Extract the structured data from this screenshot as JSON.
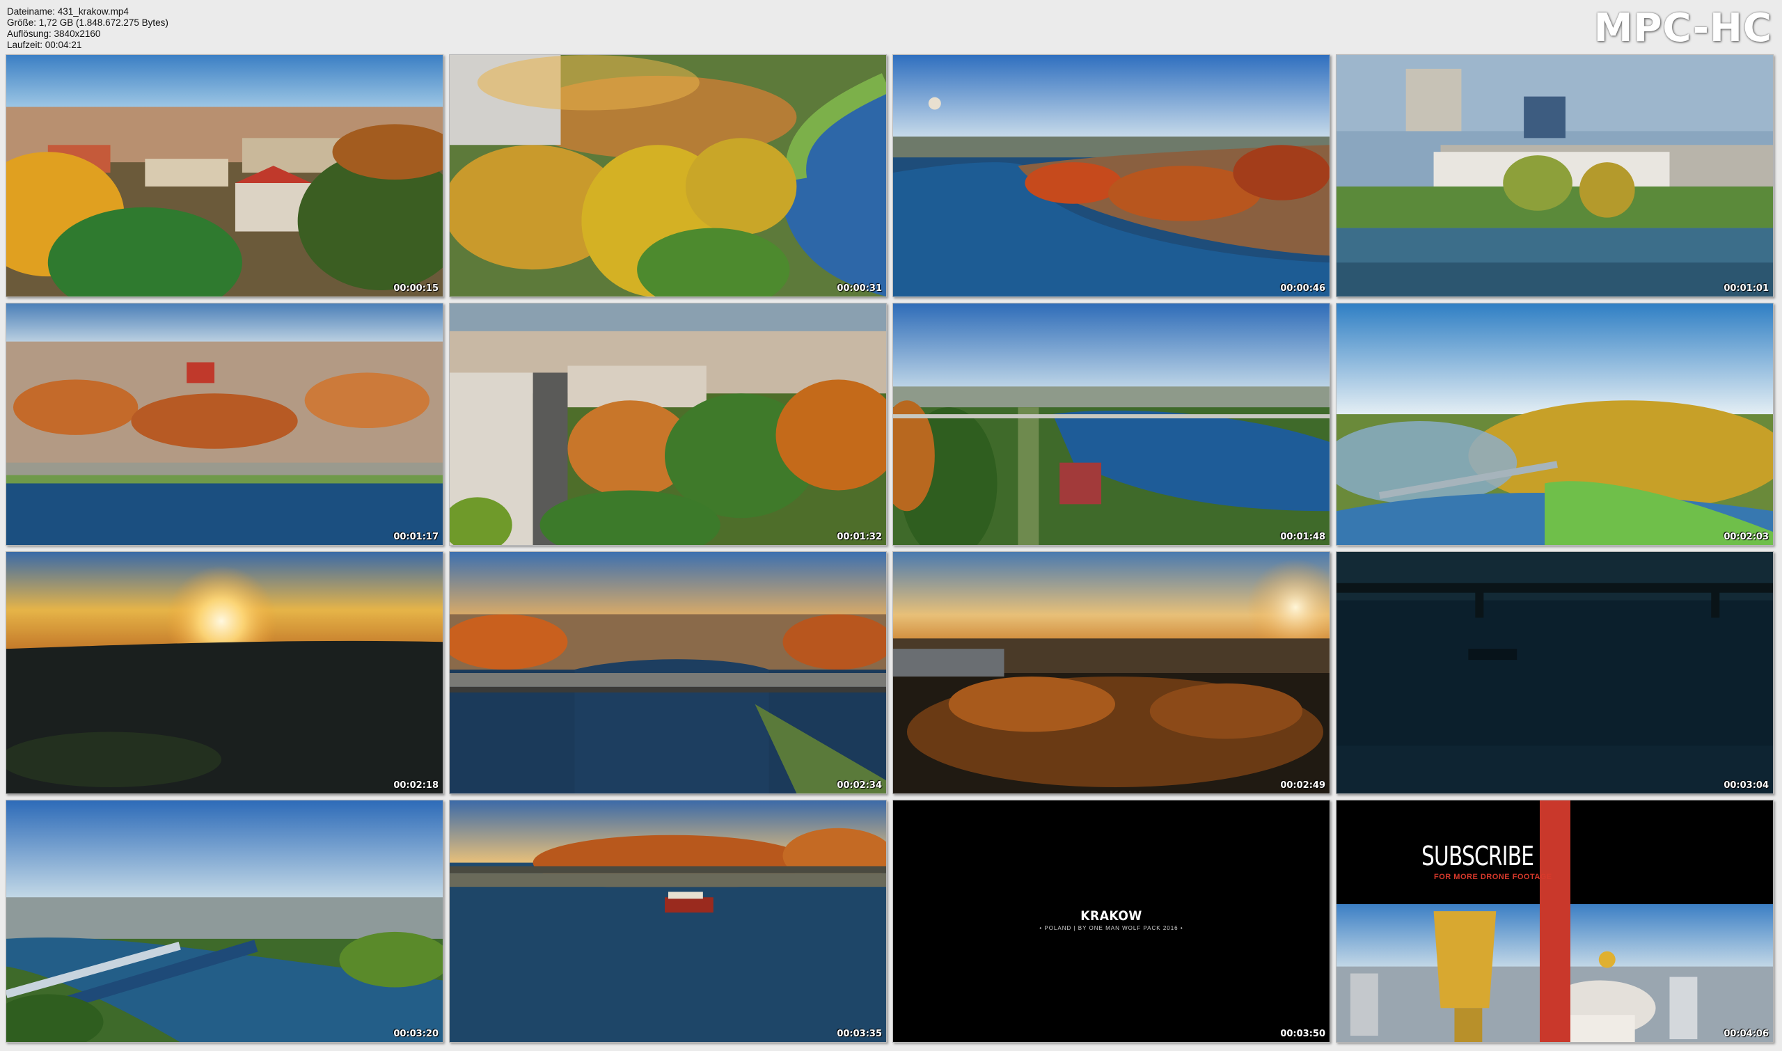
{
  "header": {
    "filename": "Dateiname: 431_krakow.mp4",
    "size": "Größe: 1,72 GB (1.848.672.275 Bytes)",
    "resolution": "Auflösung: 3840x2160",
    "duration": "Laufzeit: 00:04:21"
  },
  "logo": "MPC-HC",
  "thumbnails": [
    {
      "timestamp": "00:00:15",
      "scene": "old-town-autumn"
    },
    {
      "timestamp": "00:00:31",
      "scene": "river-bend-autumn"
    },
    {
      "timestamp": "00:00:46",
      "scene": "river-balloon"
    },
    {
      "timestamp": "00:01:01",
      "scene": "modern-building-river"
    },
    {
      "timestamp": "00:01:17",
      "scene": "city-panorama-river"
    },
    {
      "timestamp": "00:01:32",
      "scene": "street-trees"
    },
    {
      "timestamp": "00:01:48",
      "scene": "river-park"
    },
    {
      "timestamp": "00:02:03",
      "scene": "hazy-bridge-crossfade"
    },
    {
      "timestamp": "00:02:18",
      "scene": "sunset"
    },
    {
      "timestamp": "00:02:34",
      "scene": "bridge-evening"
    },
    {
      "timestamp": "00:02:49",
      "scene": "sunset-forest"
    },
    {
      "timestamp": "00:03:04",
      "scene": "dark-river"
    },
    {
      "timestamp": "00:03:20",
      "scene": "bridge-aerial"
    },
    {
      "timestamp": "00:03:35",
      "scene": "boat-river"
    },
    {
      "timestamp": "00:03:50",
      "scene": "title-card",
      "title": "KRAKOW",
      "subtitle": "• POLAND | BY ONE MAN WOLF PACK 2016 •"
    },
    {
      "timestamp": "00:04:06",
      "scene": "subscribe-card",
      "title": "SUBSCRIBE",
      "subtitle": "FOR MORE DRONE FOOTAGE"
    }
  ]
}
